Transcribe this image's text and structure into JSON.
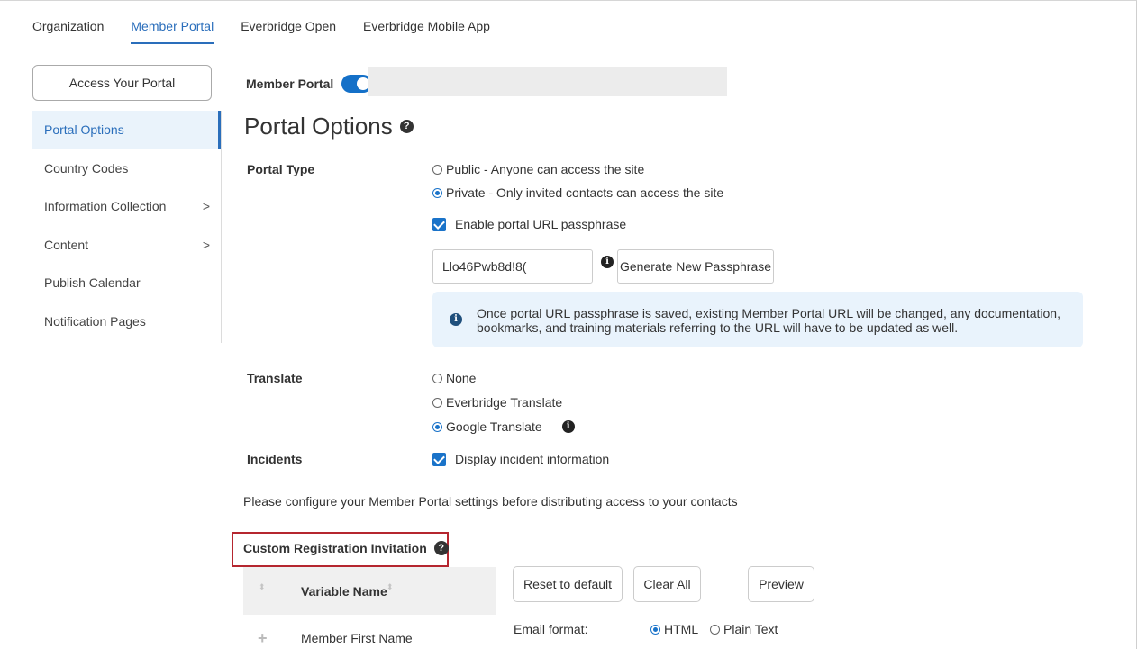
{
  "tabs": [
    {
      "label": "Organization"
    },
    {
      "label": "Member Portal"
    },
    {
      "label": "Everbridge Open"
    },
    {
      "label": "Everbridge Mobile App"
    }
  ],
  "sidebar": {
    "access_button": "Access Your Portal",
    "items": [
      {
        "label": "Portal Options",
        "chevron": ""
      },
      {
        "label": "Country Codes",
        "chevron": ""
      },
      {
        "label": "Information Collection",
        "chevron": ">"
      },
      {
        "label": "Content",
        "chevron": ">"
      },
      {
        "label": "Publish Calendar",
        "chevron": ""
      },
      {
        "label": "Notification Pages",
        "chevron": ""
      }
    ]
  },
  "header": {
    "member_portal_label": "Member Portal",
    "member_portal_enabled": true,
    "title": "Portal Options",
    "help_glyph": "?"
  },
  "portal_type": {
    "label": "Portal Type",
    "options": [
      {
        "label": "Public - Anyone can access the site",
        "selected": false
      },
      {
        "label": "Private - Only invited contacts can access the site",
        "selected": true
      }
    ],
    "passphrase_checkbox": "Enable portal URL passphrase",
    "passphrase_value": "Llo46Pwb8d!8(",
    "generate_button": "Generate New Passphrase",
    "info_glyph": "i",
    "alert_text": "Once portal URL passphrase is saved, existing Member Portal URL will be changed, any documentation, bookmarks, and training materials referring to the URL will have to be updated as well."
  },
  "translate": {
    "label": "Translate",
    "options": [
      {
        "label": "None",
        "selected": false
      },
      {
        "label": "Everbridge Translate",
        "selected": false
      },
      {
        "label": "Google Translate",
        "selected": true
      }
    ],
    "info_glyph": "i"
  },
  "incidents": {
    "label": "Incidents",
    "checkbox": "Display incident information"
  },
  "configure_text": "Please configure your Member Portal settings before distributing access to your contacts",
  "custom_invitation": {
    "title": "Custom Registration Invitation",
    "help_glyph": "?",
    "table": {
      "header": "Variable Name",
      "sort_glyph": "⬍",
      "rows": [
        {
          "plus": "+",
          "name": "Member First Name"
        }
      ]
    },
    "buttons": {
      "reset": "Reset to default",
      "clear": "Clear All",
      "preview": "Preview"
    },
    "email_format_label": "Email format:",
    "email_formats": [
      {
        "label": "HTML",
        "selected": true
      },
      {
        "label": "Plain Text",
        "selected": false
      }
    ]
  },
  "colors": {
    "accent": "#2a6ebb",
    "toggle": "#1470c8",
    "alert_bg": "#e9f3fc",
    "highlight_border": "#b5262f"
  }
}
